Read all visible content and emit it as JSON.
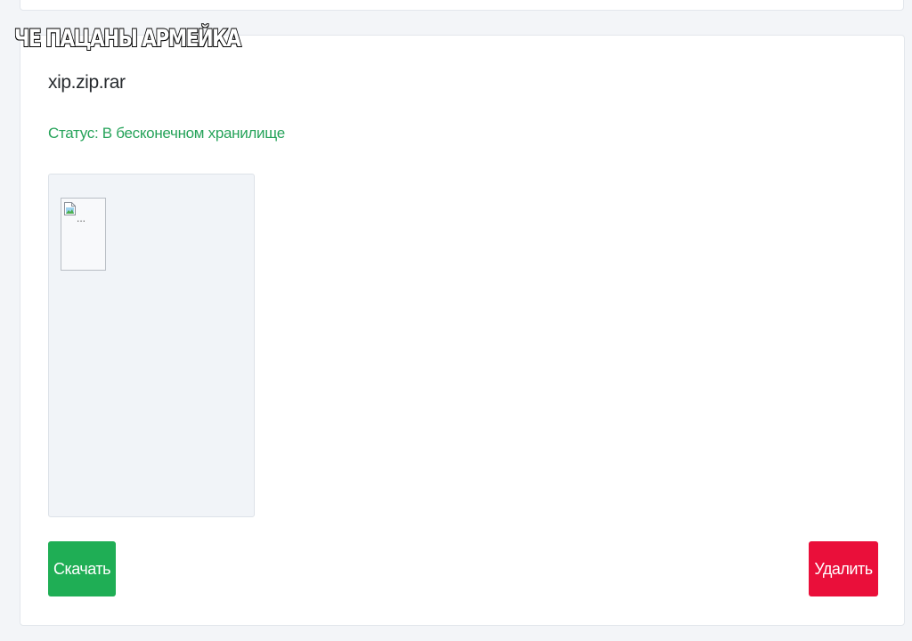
{
  "watermark": {
    "text": "ЧЕ ПАЦАНЫ АРМЕЙКА"
  },
  "file": {
    "name": "xip.zip.rar",
    "status": "Статус: В бесконечном хранилище",
    "preview_alt": "..."
  },
  "actions": {
    "download_label": "Скачать",
    "delete_label": "Удалить"
  },
  "colors": {
    "status_text": "#26a35a",
    "download_button": "#1fae55",
    "delete_button": "#ea0f3a",
    "page_background": "#f3f5f8"
  },
  "icons": {
    "preview": "broken-image-icon"
  }
}
